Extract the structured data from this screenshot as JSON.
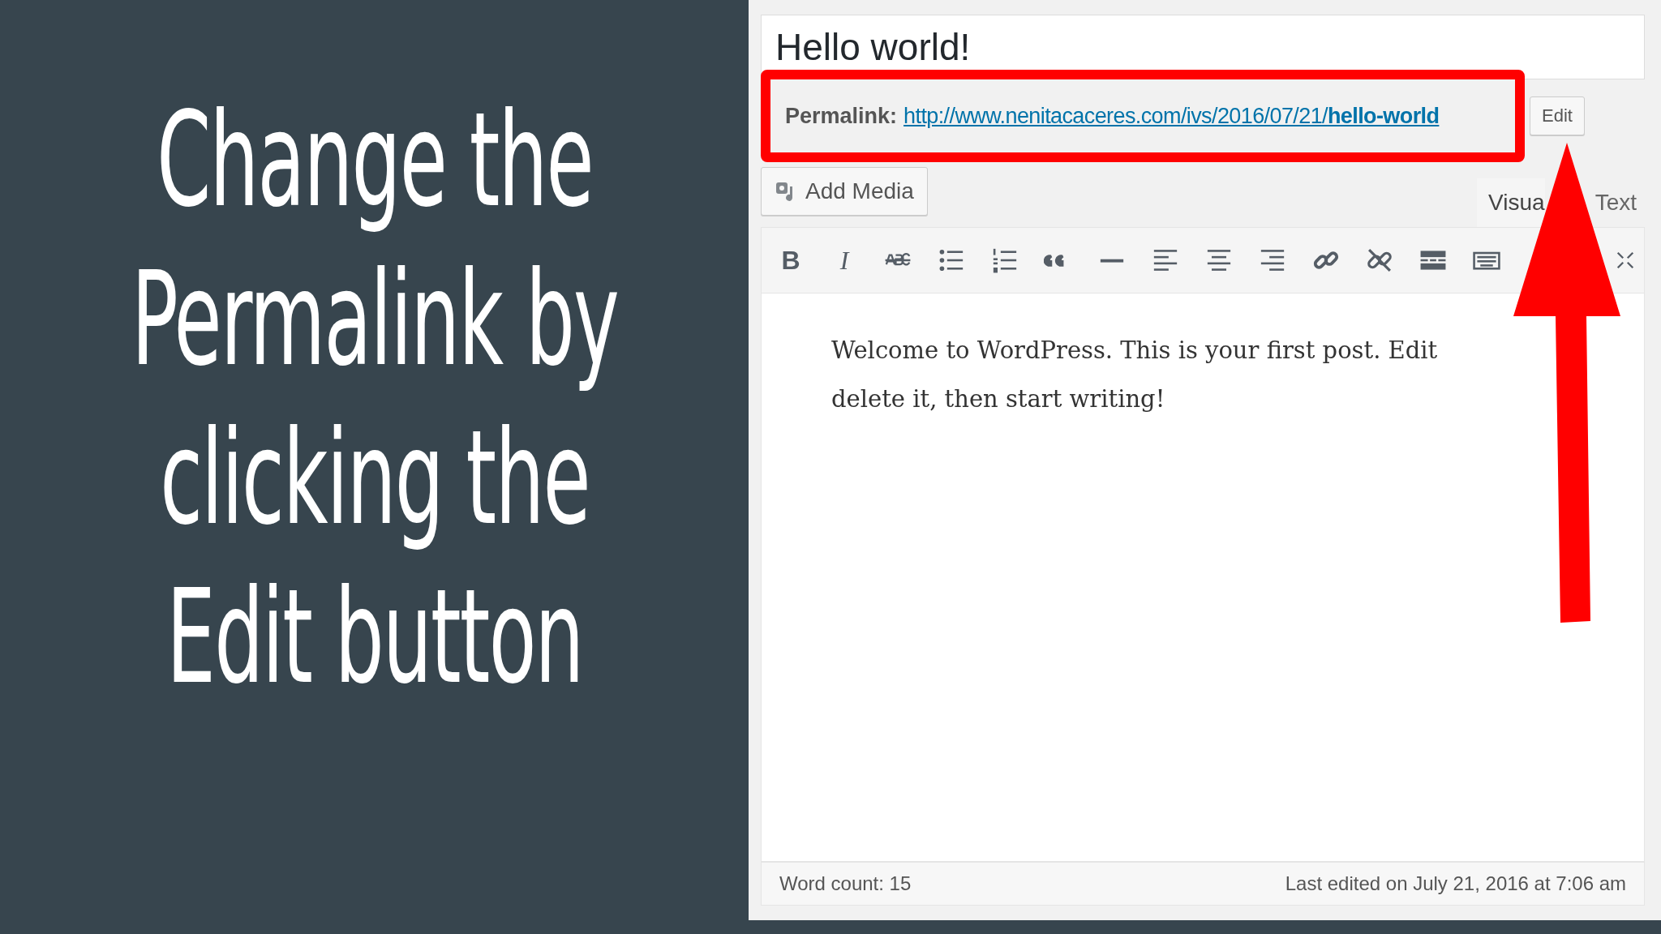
{
  "headline": "Change the Permalink by clicking the Edit button",
  "editor": {
    "title": "Hello world!",
    "permalink": {
      "label": "Permalink:",
      "url_base": "http://www.nenitacaceres.com/ivs/2016/07/21/",
      "slug": "hello-world",
      "highlighted": true
    },
    "edit_button": "Edit",
    "add_media": "Add Media",
    "tabs": [
      {
        "label": "Visua",
        "selected": true
      },
      {
        "label": "Text",
        "selected": false
      }
    ],
    "toolbar": [
      {
        "kind": "bold",
        "glyph": "B"
      },
      {
        "kind": "italic",
        "glyph": "I"
      },
      {
        "kind": "strike"
      },
      {
        "kind": "bullets"
      },
      {
        "kind": "numbers"
      },
      {
        "kind": "quote"
      },
      {
        "kind": "hr"
      },
      {
        "kind": "align-left"
      },
      {
        "kind": "align-center"
      },
      {
        "kind": "align-right"
      },
      {
        "kind": "link"
      },
      {
        "kind": "unlink"
      },
      {
        "kind": "more"
      },
      {
        "kind": "keyboard"
      },
      {
        "kind": "fullscreen"
      }
    ],
    "content_lines": [
      "Welcome to WordPress. This is your first post. Edit",
      "delete it, then start writing!"
    ],
    "word_count": "Word count: 15",
    "last_edited": "Last edited on July 21, 2016 at 7:06 am"
  },
  "pointer_arrow": true
}
